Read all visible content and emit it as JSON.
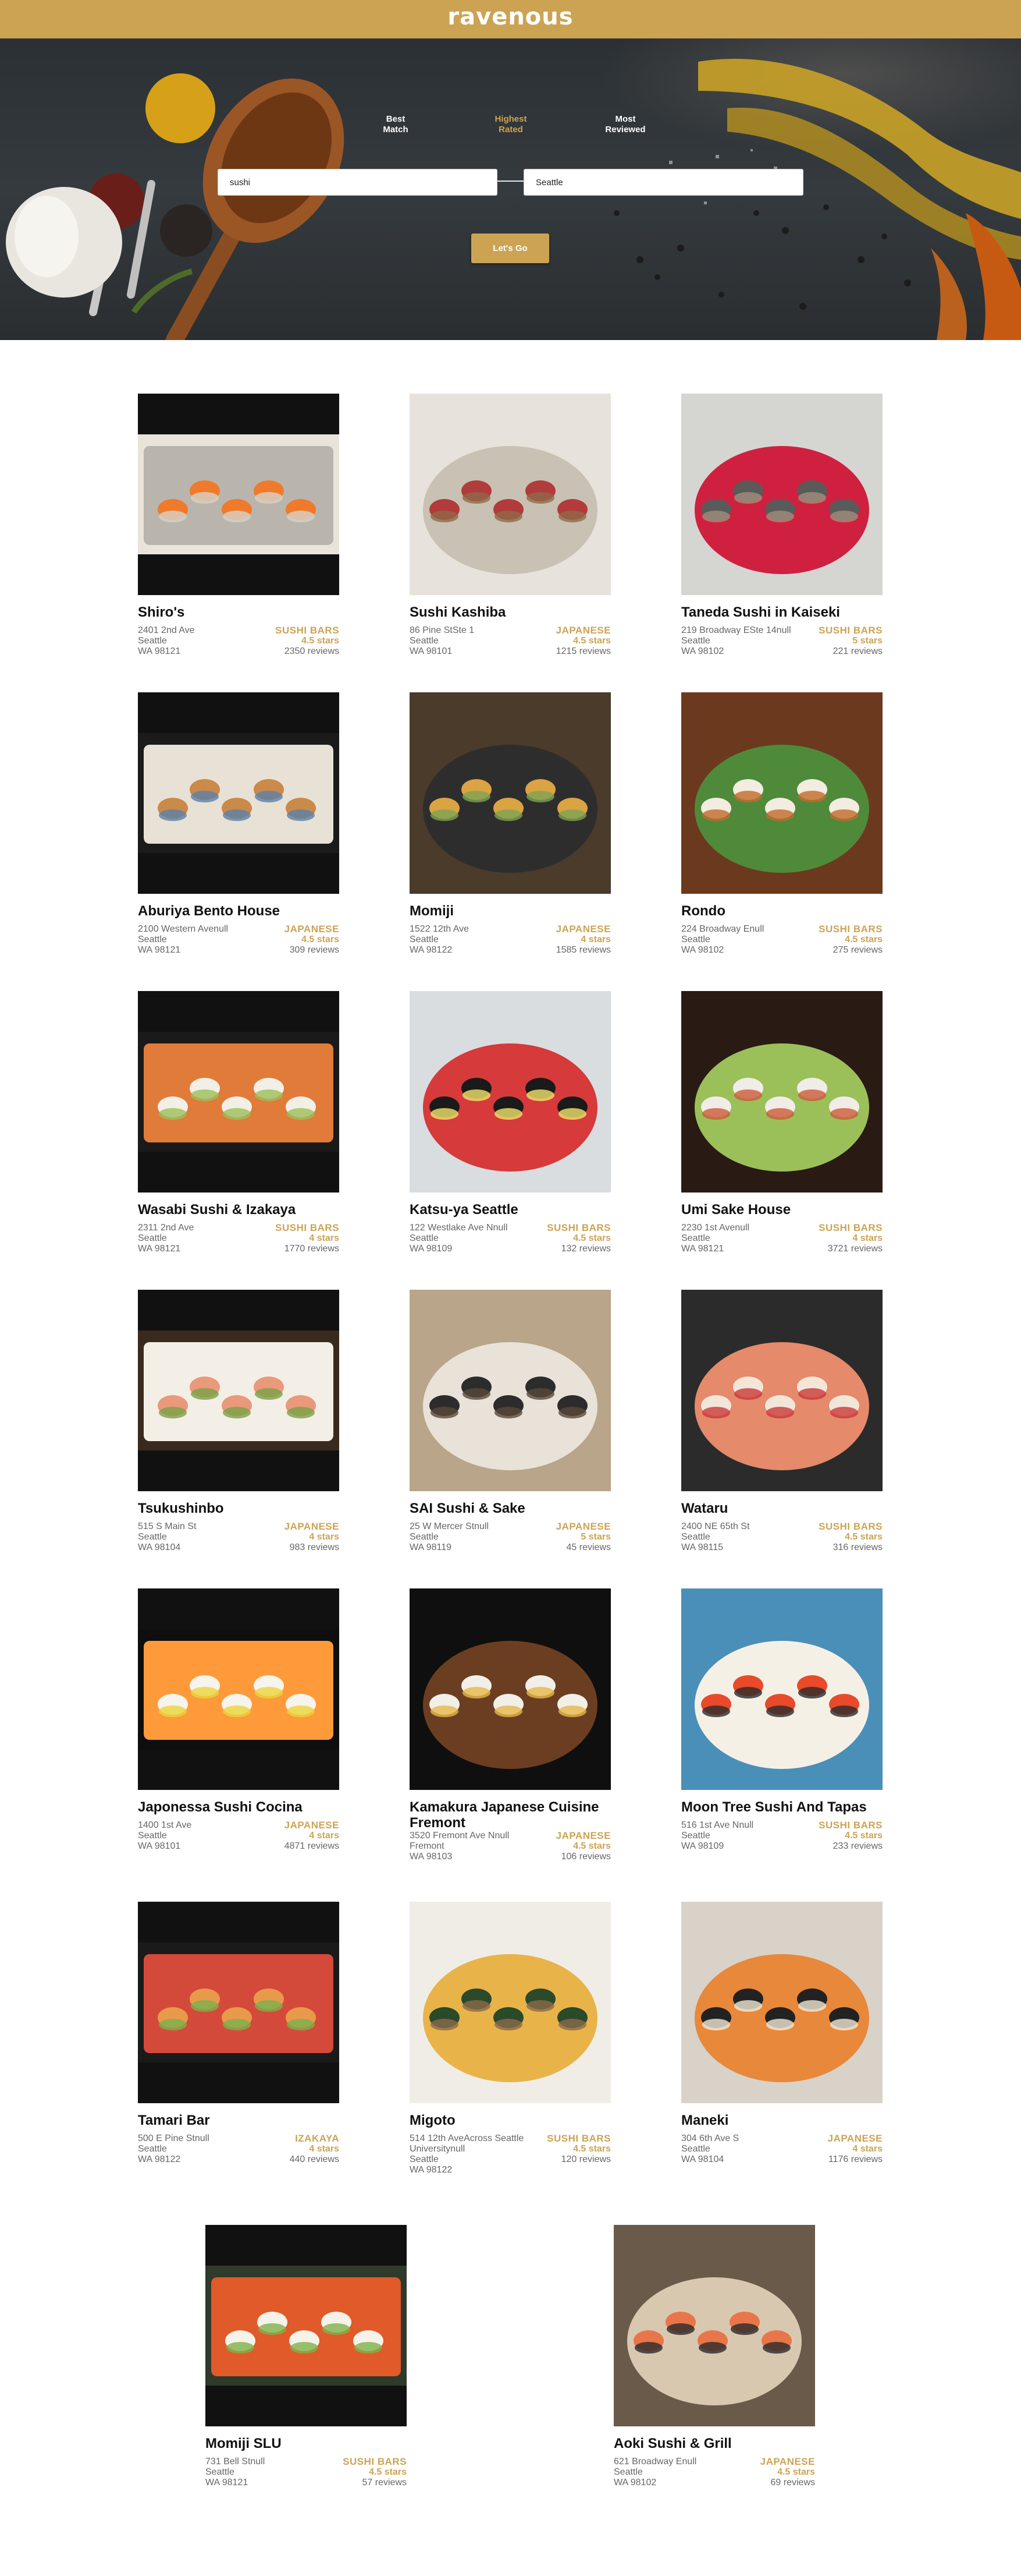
{
  "app": {
    "logo": "ravenous"
  },
  "sort_options": [
    {
      "label": "Best\nMatch",
      "active": false
    },
    {
      "label": "Highest\nRated",
      "active": true
    },
    {
      "label": "Most\nReviewed",
      "active": false
    }
  ],
  "search": {
    "term_value": "sushi",
    "location_value": "Seattle",
    "submit_label": "Let's Go"
  },
  "colors": {
    "accent": "#cca353",
    "text_muted": "#666666"
  },
  "businesses": [
    {
      "name": "Shiro's",
      "address": "2401 2nd Ave",
      "city": "Seattle",
      "zip": "WA 98121",
      "category": "SUSHI BARS",
      "rating": "4.5 stars",
      "reviews": "2350 reviews",
      "image_icon": "sushi-plate-photo"
    },
    {
      "name": "Sushi Kashiba",
      "address": "86 Pine StSte 1",
      "city": "Seattle",
      "zip": "WA 98101",
      "category": "JAPANESE",
      "rating": "4.5 stars",
      "reviews": "1215 reviews",
      "image_icon": "sashimi-plate-photo"
    },
    {
      "name": "Taneda Sushi in Kaiseki",
      "address": "219 Broadway ESte 14null",
      "city": "Seattle",
      "zip": "WA 98102",
      "category": "SUSHI BARS",
      "rating": "5 stars",
      "reviews": "221 reviews",
      "image_icon": "nigiri-stone-photo"
    },
    {
      "name": "Aburiya Bento House",
      "address": "2100 Western Avenull",
      "city": "Seattle",
      "zip": "WA 98121",
      "category": "JAPANESE",
      "rating": "4.5 stars",
      "reviews": "309 reviews",
      "image_icon": "bento-box-photo"
    },
    {
      "name": "Momiji",
      "address": "1522 12th Ave",
      "city": "Seattle",
      "zip": "WA 98122",
      "category": "JAPANESE",
      "rating": "4 stars",
      "reviews": "1585 reviews",
      "image_icon": "sushi-table-photo"
    },
    {
      "name": "Rondo",
      "address": "224 Broadway Enull",
      "city": "Seattle",
      "zip": "WA 98102",
      "category": "SUSHI BARS",
      "rating": "4.5 stars",
      "reviews": "275 reviews",
      "image_icon": "scallop-dish-photo"
    },
    {
      "name": "Wasabi Sushi & Izakaya",
      "address": "2311 2nd Ave",
      "city": "Seattle",
      "zip": "WA 98121",
      "category": "SUSHI BARS",
      "rating": "4 stars",
      "reviews": "1770 reviews",
      "image_icon": "sushi-roll-photo"
    },
    {
      "name": "Katsu-ya Seattle",
      "address": "122 Westlake Ave Nnull",
      "city": "Seattle",
      "zip": "WA 98109",
      "category": "SUSHI BARS",
      "rating": "4.5 stars",
      "reviews": "132 reviews",
      "image_icon": "noodle-bowl-photo"
    },
    {
      "name": "Umi Sake House",
      "address": "2230 1st Avenull",
      "city": "Seattle",
      "zip": "WA 98121",
      "category": "SUSHI BARS",
      "rating": "4 stars",
      "reviews": "3721 reviews",
      "image_icon": "sushi-platter-photo"
    },
    {
      "name": "Tsukushinbo",
      "address": "515 S Main St",
      "city": "Seattle",
      "zip": "WA 98104",
      "category": "JAPANESE",
      "rating": "4 stars",
      "reviews": "983 reviews",
      "image_icon": "nigiri-board-photo"
    },
    {
      "name": "SAI Sushi & Sake",
      "address": "25 W Mercer Stnull",
      "city": "Seattle",
      "zip": "WA 98119",
      "category": "JAPANESE",
      "rating": "5 stars",
      "reviews": "45 reviews",
      "image_icon": "sushi-counter-photo"
    },
    {
      "name": "Wataru",
      "address": "2400 NE 65th St",
      "city": "Seattle",
      "zip": "WA 98115",
      "category": "SUSHI BARS",
      "rating": "4.5 stars",
      "reviews": "316 reviews",
      "image_icon": "nigiri-plate-photo"
    },
    {
      "name": "Japonessa Sushi Cocina",
      "address": "1400 1st Ave",
      "city": "Seattle",
      "zip": "WA 98101",
      "category": "JAPANESE",
      "rating": "4 stars",
      "reviews": "4871 reviews",
      "image_icon": "sushi-rolls-photo"
    },
    {
      "name": "Kamakura Japanese Cuisine Fremont",
      "address": "3520 Fremont Ave Nnull",
      "city": "Fremont",
      "zip": "WA 98103",
      "category": "JAPANESE",
      "rating": "4.5 stars",
      "reviews": "106 reviews",
      "image_icon": "roll-plate-photo"
    },
    {
      "name": "Moon Tree Sushi And Tapas",
      "address": "516 1st Ave Nnull",
      "city": "Seattle",
      "zip": "WA 98109",
      "category": "SUSHI BARS",
      "rating": "4.5 stars",
      "reviews": "233 reviews",
      "image_icon": "sushi-tower-photo"
    },
    {
      "name": "Tamari Bar",
      "address": "500 E Pine Stnull",
      "city": "Seattle",
      "zip": "WA 98122",
      "category": "IZAKAYA",
      "rating": "4 stars",
      "reviews": "440 reviews",
      "image_icon": "sashimi-platter-photo"
    },
    {
      "name": "Migoto",
      "address": "514 12th AveAcross Seattle Universitynull",
      "city": "Seattle",
      "zip": "WA 98122",
      "category": "SUSHI BARS",
      "rating": "4.5 stars",
      "reviews": "120 reviews",
      "image_icon": "dragon-roll-photo"
    },
    {
      "name": "Maneki",
      "address": "304 6th Ave S",
      "city": "Seattle",
      "zip": "WA 98104",
      "category": "JAPANESE",
      "rating": "4 stars",
      "reviews": "1176 reviews",
      "image_icon": "shrimp-tempura-photo"
    },
    {
      "name": "Momiji SLU",
      "address": "731 Bell Stnull",
      "city": "Seattle",
      "zip": "WA 98121",
      "category": "SUSHI BARS",
      "rating": "4.5 stars",
      "reviews": "57 reviews",
      "image_icon": "chirashi-bowl-photo"
    },
    {
      "name": "Aoki Sushi & Grill",
      "address": "621 Broadway Enull",
      "city": "Seattle",
      "zip": "WA 98102",
      "category": "JAPANESE",
      "rating": "4.5 stars",
      "reviews": "69 reviews",
      "image_icon": "shrimp-dish-photo"
    }
  ]
}
